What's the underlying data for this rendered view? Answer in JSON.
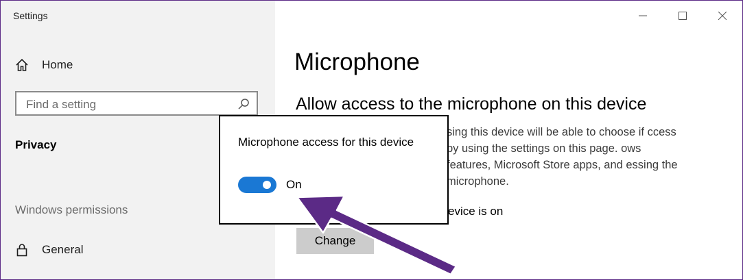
{
  "window": {
    "title": "Settings",
    "controls": [
      "minimize-icon",
      "maximize-icon",
      "close-icon"
    ]
  },
  "sidebar": {
    "home_label": "Home",
    "search_placeholder": "Find a setting",
    "section_privacy": "Privacy",
    "section_windows_permissions": "Windows permissions",
    "general_label": "General"
  },
  "main": {
    "title": "Microphone",
    "heading": "Allow access to the microphone on this device",
    "description_fragment": "sing this device will be able to choose if ccess by using the settings on this page. ows features, Microsoft Store apps, and essing the microphone.",
    "status_fragment": "evice is on",
    "change_button": "Change"
  },
  "popup": {
    "title": "Microphone access for this device",
    "toggle_state": "On",
    "toggle_on": true
  },
  "colors": {
    "accent": "#1a78d4",
    "sidebar_bg": "#f2f2f2",
    "arrow": "#5b2a86",
    "window_border": "#5b2a86"
  }
}
